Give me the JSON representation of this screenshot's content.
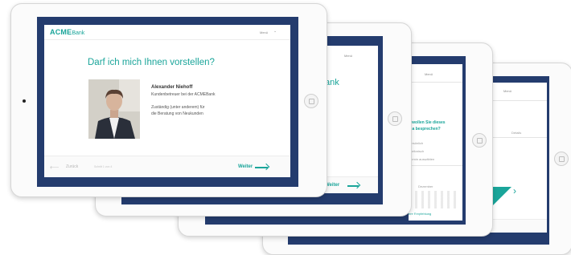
{
  "front": {
    "logo_bold": "ACME",
    "logo_light": "Bank",
    "menu": "Menü",
    "title": "Darf ich mich Ihnen vorstellen?",
    "advisor": {
      "name": "Alexander Niehoff",
      "role": "Kundenbetreuer bei der ACMEBank",
      "resp_line1": "Zuständig (unter anderem) für",
      "resp_line2": "die Beratung von Neukunden"
    },
    "footer": {
      "back": "Zurück",
      "step": "Schritt 1 von 4",
      "next": "Weiter"
    }
  },
  "second": {
    "menu": "Menü",
    "title_fragment": "ank",
    "next": "Weiter"
  },
  "third": {
    "menu": "Menü",
    "prompt_line1": "e wollen Sie dieses",
    "prompt_line2": "ma besprechen?",
    "row1": "persönlich",
    "row2": "telefonisch",
    "row3": "Termin auswählen",
    "calendar_month": "Dezember",
    "link": "ere Empfehlung",
    "next": "Weiter"
  },
  "fourth": {
    "menu": "Menü",
    "field": "Details"
  },
  "colors": {
    "accent": "#1aa59a",
    "frame": "#243c6e",
    "text": "#333333"
  }
}
